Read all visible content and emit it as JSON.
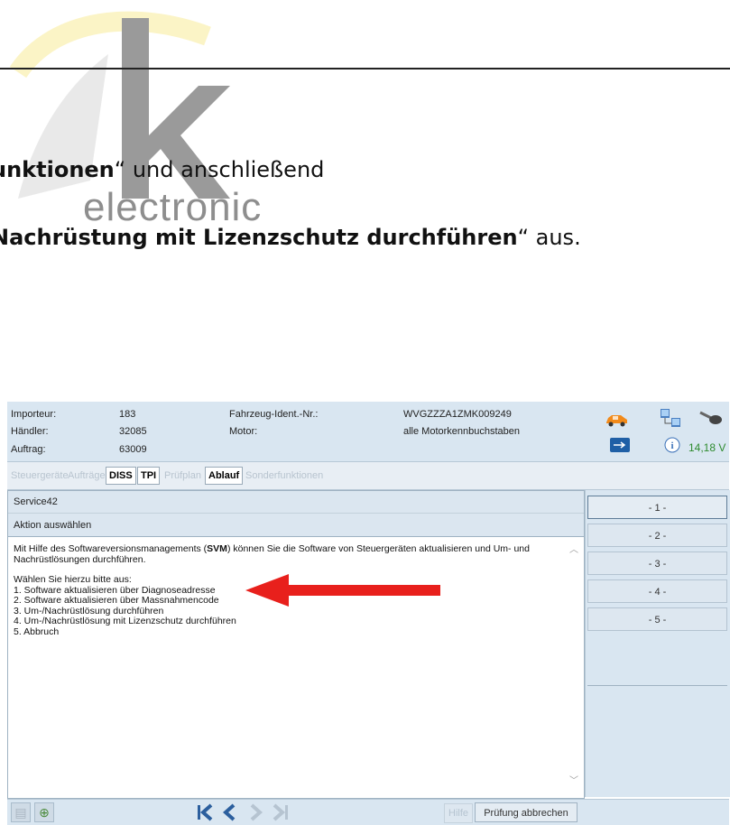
{
  "logo": {
    "text": "electronic"
  },
  "doc": {
    "line1": {
      "bold": "unktionen",
      "rest": "“ und anschließend"
    },
    "line2": {
      "bold": "Nachrüstung mit Lizenzschutz durchführen",
      "rest": "“ aus."
    }
  },
  "info": {
    "importeur_label": "Importeur:",
    "importeur_value": "183",
    "haendler_label": "Händler:",
    "haendler_value": "32085",
    "auftrag_label": "Auftrag:",
    "auftrag_value": "63009",
    "fin_label": "Fahrzeug-Ident.-Nr.:",
    "fin_value": "WVGZZZA1ZMK009249",
    "motor_label": "Motor:",
    "motor_value": "alle Motorkennbuchstaben",
    "voltage": "14,18 V"
  },
  "tabs": [
    {
      "label": "Steuergeräte"
    },
    {
      "label": "Aufträge"
    },
    {
      "label": "DISS"
    },
    {
      "label": "TPI"
    },
    {
      "label": "Prüfplan"
    },
    {
      "label": "Ablauf"
    },
    {
      "label": "Sonderfunktionen"
    }
  ],
  "main": {
    "title": "Service42",
    "subtitle": "Aktion auswählen",
    "intro_a": "Mit Hilfe des Softwareversionsmanagements (",
    "intro_bold": "SVM",
    "intro_b": ") können Sie die Software von Steuergeräten aktualisieren und Um- und",
    "intro_c": "Nachrüstlösungen durchführen.",
    "choose": "Wählen Sie hierzu bitte aus:",
    "options": [
      "1. Software aktualisieren über Diagnoseadresse",
      "2. Software aktualisieren über Massnahmencode",
      "3. Um-/Nachrüstlösung durchführen",
      "4. Um-/Nachrüstlösung mit Lizenzschutz durchführen",
      "5. Abbruch"
    ]
  },
  "side_buttons": [
    "- 1 -",
    "- 2 -",
    "- 3 -",
    "- 4 -",
    "- 5 -"
  ],
  "footer": {
    "help": "Hilfe",
    "abort": "Prüfung abbrechen"
  },
  "colors": {
    "panel": "#d9e6f1",
    "arrow": "#e8201c",
    "voltage": "#2e8b2e",
    "nav_active": "#2c5f9e"
  },
  "icons": [
    "car-icon",
    "network-icon",
    "key-icon",
    "usb-icon",
    "info-icon",
    "first-page-icon",
    "prev-page-icon",
    "next-page-icon",
    "last-page-icon"
  ]
}
